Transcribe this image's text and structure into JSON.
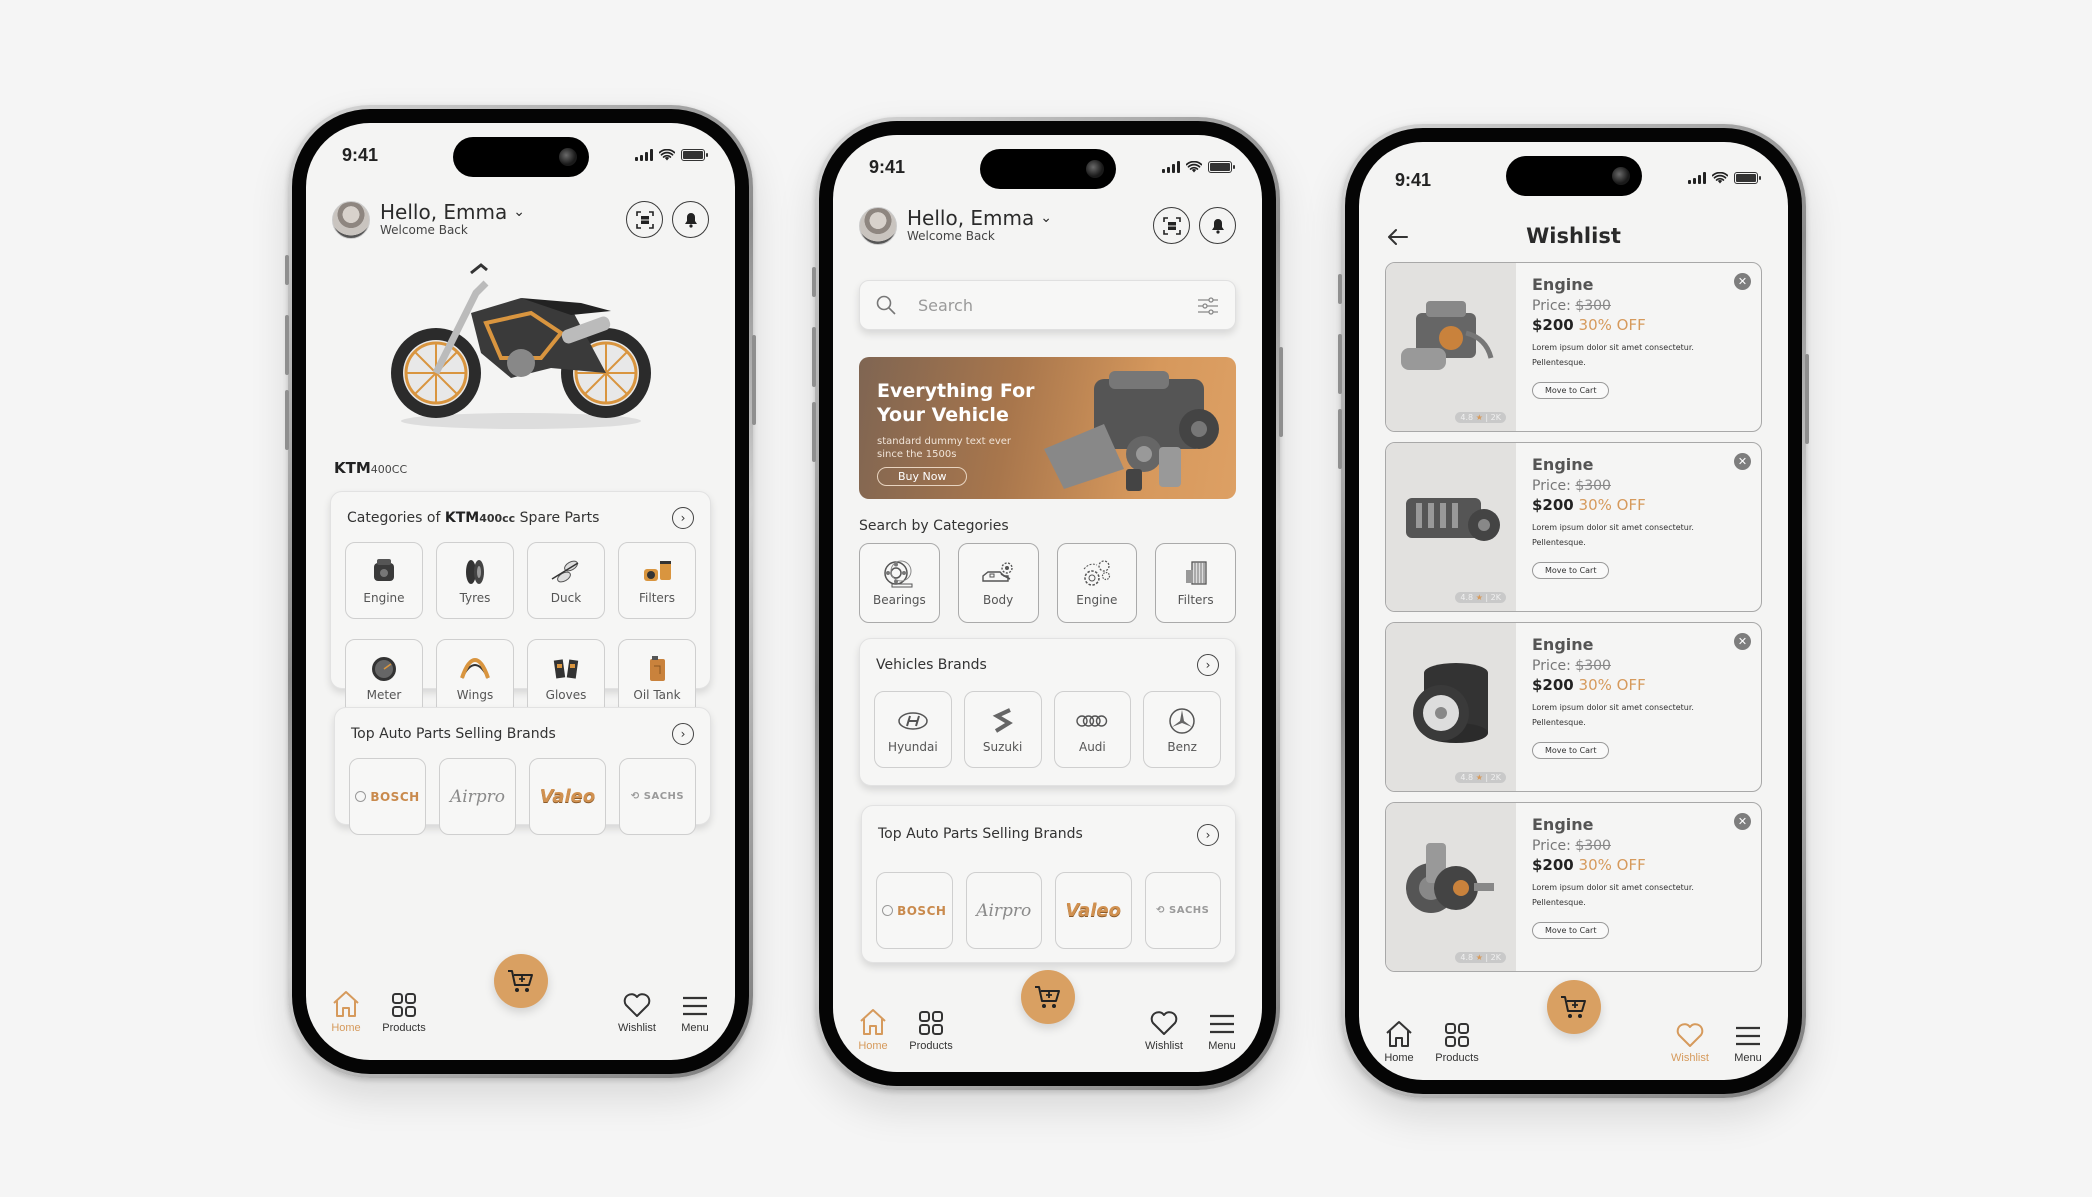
{
  "colors": {
    "accent": "#d9a062",
    "accent_text": "#d69a5c",
    "background": "#f5f5f5",
    "screen": "#f4f4f3",
    "banner_start": "#7f6552",
    "banner_end": "#dda064"
  },
  "status_bar": {
    "time": "9:41"
  },
  "user_header": {
    "greeting": "Hello, Emma",
    "subtitle": "Welcome Back",
    "scan_icon": "scan-icon",
    "bell_icon": "bell-icon"
  },
  "home_vehicle": {
    "vehicle_name": "KTM",
    "vehicle_variant": "400CC",
    "categories_card": {
      "title_prefix": "Categories of ",
      "title_vehicle": "KTM",
      "title_variant": "400cc",
      "title_suffix": " Spare Parts",
      "items": [
        {
          "label": "Engine",
          "icon": "engine-icon"
        },
        {
          "label": "Tyres",
          "icon": "tyres-icon"
        },
        {
          "label": "Duck",
          "icon": "mirror-icon"
        },
        {
          "label": "Filters",
          "icon": "filters-icon"
        },
        {
          "label": "Meter",
          "icon": "meter-icon"
        },
        {
          "label": "Wings",
          "icon": "wings-icon"
        },
        {
          "label": "Gloves",
          "icon": "gloves-icon"
        },
        {
          "label": "Oil Tank",
          "icon": "oil-tank-icon"
        }
      ]
    },
    "brands_card": {
      "title": "Top Auto Parts Selling Brands",
      "brands": [
        "BOSCH",
        "Airpro",
        "Valeo",
        "SACHS"
      ]
    }
  },
  "home_search": {
    "search_placeholder": "Search",
    "banner": {
      "title_line1": "Everything For",
      "title_line2": "Your Vehicle",
      "subtitle_line1": "standard dummy text ever",
      "subtitle_line2": "since the 1500s",
      "button": "Buy Now"
    },
    "categories_title": "Search by Categories",
    "categories": [
      {
        "label": "Bearings",
        "icon": "bearings-icon"
      },
      {
        "label": "Body",
        "icon": "car-body-icon"
      },
      {
        "label": "Engine",
        "icon": "gears-icon"
      },
      {
        "label": "Filters",
        "icon": "air-filter-icon"
      }
    ],
    "vehicle_brands_card": {
      "title": "Vehicles Brands",
      "brands": [
        {
          "label": "Hyundai",
          "icon": "hyundai-logo-icon"
        },
        {
          "label": "Suzuki",
          "icon": "suzuki-logo-icon"
        },
        {
          "label": "Audi",
          "icon": "audi-logo-icon"
        },
        {
          "label": "Benz",
          "icon": "mercedes-logo-icon"
        }
      ]
    },
    "brands_card": {
      "title": "Top Auto Parts Selling Brands",
      "brands": [
        "BOSCH",
        "Airpro",
        "Valeo",
        "SACHS"
      ]
    }
  },
  "wishlist": {
    "title": "Wishlist",
    "items": [
      {
        "name": "Engine",
        "price_label": "Price:",
        "old_price": "$300",
        "new_price": "$200",
        "discount": "30% OFF",
        "description_line1": "Lorem ipsum dolor sit amet consectetur.",
        "description_line2": "Pellentesque.",
        "button": "Move to Cart",
        "rating": "4.8",
        "reviews": "2K",
        "image": "engine-block-image"
      },
      {
        "name": "Engine",
        "price_label": "Price:",
        "old_price": "$300",
        "new_price": "$200",
        "discount": "30% OFF",
        "description_line1": "Lorem ipsum dolor sit amet consectetur.",
        "description_line2": "Pellentesque.",
        "button": "Move to Cart",
        "rating": "4.8",
        "reviews": "2K",
        "image": "engine-motor-image"
      },
      {
        "name": "Engine",
        "price_label": "Price:",
        "old_price": "$300",
        "new_price": "$200",
        "discount": "30% OFF",
        "description_line1": "Lorem ipsum dolor sit amet consectetur.",
        "description_line2": "Pellentesque.",
        "button": "Move to Cart",
        "rating": "4.8",
        "reviews": "2K",
        "image": "tyres-stack-image"
      },
      {
        "name": "Engine",
        "price_label": "Price:",
        "old_price": "$300",
        "new_price": "$200",
        "discount": "30% OFF",
        "description_line1": "Lorem ipsum dolor sit amet consectetur.",
        "description_line2": "Pellentesque.",
        "button": "Move to Cart",
        "rating": "4.8",
        "reviews": "2K",
        "image": "clutch-assembly-image"
      }
    ]
  },
  "bottom_nav": {
    "items": [
      {
        "label": "Home",
        "icon": "home-icon"
      },
      {
        "label": "Products",
        "icon": "grid-icon"
      },
      {
        "label": "Wishlist",
        "icon": "heart-icon"
      },
      {
        "label": "Menu",
        "icon": "menu-icon"
      }
    ],
    "cart_icon": "cart-plus-icon",
    "active_phone1": "Home",
    "active_phone2": "Home",
    "active_phone3": "Wishlist"
  }
}
